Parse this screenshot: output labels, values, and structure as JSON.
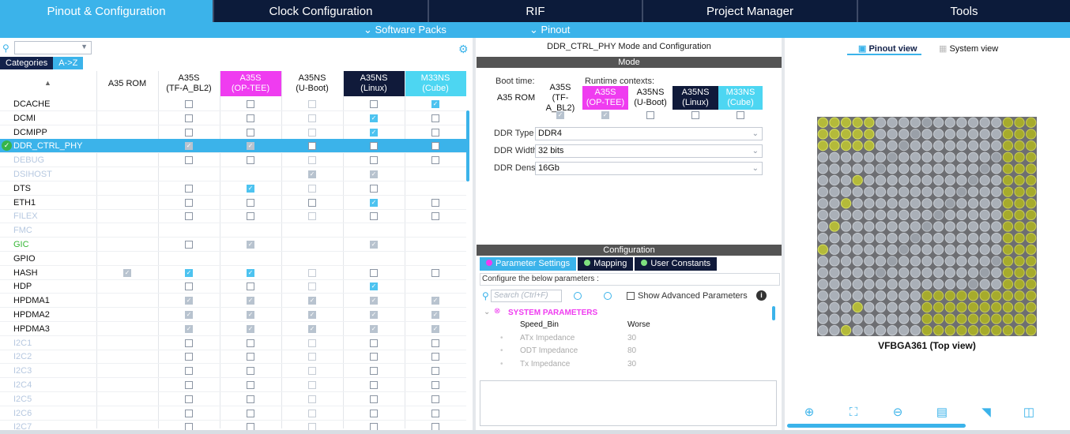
{
  "tabs": [
    {
      "label": "Pinout & Configuration",
      "active": true
    },
    {
      "label": "Clock Configuration",
      "active": false
    },
    {
      "label": "RIF",
      "active": false
    },
    {
      "label": "Project Manager",
      "active": false
    },
    {
      "label": "Tools",
      "active": false
    }
  ],
  "subbar": {
    "software_packs": "⌄ Software Packs",
    "pinout": "⌄ Pinout"
  },
  "left": {
    "category_tabs": [
      "Categories",
      "A->Z"
    ],
    "columns": [
      {
        "label": "A35 ROM",
        "style": "plain"
      },
      {
        "label": "A35S\n(TF-A_BL2)",
        "style": "plain"
      },
      {
        "label": "A35S\n(OP-TEE)",
        "style": "magenta"
      },
      {
        "label": "A35NS\n(U-Boot)",
        "style": "plain"
      },
      {
        "label": "A35NS\n(Linux)",
        "style": "navy"
      },
      {
        "label": "M33NS\n(Cube)",
        "style": "cyan"
      }
    ],
    "rows": [
      {
        "name": "DCACHE",
        "style": "normal",
        "cells": [
          "",
          "off",
          "off",
          "grey",
          "off",
          "on"
        ]
      },
      {
        "name": "DCMI",
        "style": "normal",
        "cells": [
          "",
          "off",
          "off",
          "grey",
          "on",
          "off"
        ]
      },
      {
        "name": "DCMIPP",
        "style": "normal",
        "cells": [
          "",
          "off",
          "off",
          "grey",
          "on",
          "off"
        ]
      },
      {
        "name": "DDR_CTRL_PHY",
        "style": "selected",
        "cells": [
          "",
          "greyon",
          "greyon",
          "off",
          "off",
          "off"
        ]
      },
      {
        "name": "DEBUG",
        "style": "dim",
        "cells": [
          "",
          "off",
          "off",
          "grey",
          "off",
          "off"
        ]
      },
      {
        "name": "DSIHOST",
        "style": "dim",
        "cells": [
          "",
          "",
          "",
          "greyon",
          "greyon",
          ""
        ]
      },
      {
        "name": "DTS",
        "style": "normal",
        "cells": [
          "",
          "off",
          "on",
          "grey",
          "off",
          ""
        ]
      },
      {
        "name": "ETH1",
        "style": "normal",
        "cells": [
          "",
          "off",
          "off",
          "off",
          "on",
          "off"
        ]
      },
      {
        "name": "FILEX",
        "style": "dim",
        "cells": [
          "",
          "off",
          "off",
          "grey",
          "off",
          "off"
        ]
      },
      {
        "name": "FMC",
        "style": "dim",
        "cells": [
          "",
          "",
          "",
          "",
          "",
          ""
        ]
      },
      {
        "name": "GIC",
        "style": "green",
        "cells": [
          "",
          "off",
          "greyon",
          "",
          "greyon",
          ""
        ]
      },
      {
        "name": "GPIO",
        "style": "normal",
        "cells": [
          "",
          "",
          "",
          "",
          "",
          ""
        ]
      },
      {
        "name": "HASH",
        "style": "normal",
        "cells": [
          "greyon",
          "on",
          "on",
          "grey",
          "off",
          "off"
        ]
      },
      {
        "name": "HDP",
        "style": "normal",
        "cells": [
          "",
          "off",
          "off",
          "grey",
          "on",
          ""
        ]
      },
      {
        "name": "HPDMA1",
        "style": "normal",
        "cells": [
          "",
          "greyon",
          "greyon",
          "greyon",
          "greyon",
          "greyon"
        ]
      },
      {
        "name": "HPDMA2",
        "style": "normal",
        "cells": [
          "",
          "greyon",
          "greyon",
          "greyon",
          "greyon",
          "greyon"
        ]
      },
      {
        "name": "HPDMA3",
        "style": "normal",
        "cells": [
          "",
          "greyon",
          "greyon",
          "greyon",
          "greyon",
          "greyon"
        ]
      },
      {
        "name": "I2C1",
        "style": "dim",
        "cells": [
          "",
          "off",
          "off",
          "grey",
          "off",
          "off"
        ]
      },
      {
        "name": "I2C2",
        "style": "dim",
        "cells": [
          "",
          "off",
          "off",
          "grey",
          "off",
          "off"
        ]
      },
      {
        "name": "I2C3",
        "style": "dim",
        "cells": [
          "",
          "off",
          "off",
          "grey",
          "off",
          "off"
        ]
      },
      {
        "name": "I2C4",
        "style": "dim",
        "cells": [
          "",
          "off",
          "off",
          "grey",
          "off",
          "off"
        ]
      },
      {
        "name": "I2C5",
        "style": "dim",
        "cells": [
          "",
          "off",
          "off",
          "grey",
          "off",
          "off"
        ]
      },
      {
        "name": "I2C6",
        "style": "dim",
        "cells": [
          "",
          "off",
          "off",
          "grey",
          "off",
          "off"
        ]
      },
      {
        "name": "I2C7",
        "style": "dim",
        "cells": [
          "",
          "off",
          "off",
          "grey",
          "off",
          "off"
        ]
      }
    ]
  },
  "mode": {
    "title": "DDR_CTRL_PHY Mode and Configuration",
    "bar": "Mode",
    "boot_time": "Boot time:",
    "runtime_contexts": "Runtime contexts:",
    "contexts": [
      {
        "label": "A35 ROM",
        "style": "plain",
        "state": ""
      },
      {
        "label": "A35S\n(TF-A_BL2)",
        "style": "plain",
        "state": "greyon"
      },
      {
        "label": "A35S\n(OP-TEE)",
        "style": "magenta",
        "state": "greyon"
      },
      {
        "label": "A35NS\n(U-Boot)",
        "style": "plain",
        "state": "off"
      },
      {
        "label": "A35NS\n(Linux)",
        "style": "navy",
        "state": "off"
      },
      {
        "label": "M33NS\n(Cube)",
        "style": "cyan",
        "state": "off"
      }
    ],
    "fields": [
      {
        "label": "DDR Type",
        "value": "DDR4"
      },
      {
        "label": "DDR Width",
        "value": "32 bits"
      },
      {
        "label": "DDR Density",
        "value": "16Gb"
      }
    ]
  },
  "config": {
    "bar": "Configuration",
    "tabs": [
      "Parameter Settings",
      "Mapping",
      "User Constants"
    ],
    "hint": "Configure the below parameters :",
    "search_placeholder": "Search (Ctrl+F)",
    "show_advanced": "Show Advanced Parameters",
    "section": "SYSTEM PARAMETERS",
    "params": [
      {
        "name": "Speed_Bin",
        "value": "Worse",
        "dim": false
      },
      {
        "name": "ATx Impedance",
        "value": "30",
        "dim": true
      },
      {
        "name": "ODT Impedance",
        "value": "80",
        "dim": true
      },
      {
        "name": "Tx Impedance",
        "value": "30",
        "dim": true
      }
    ]
  },
  "right": {
    "pinout_view": "Pinout view",
    "system_view": "System view",
    "chip_caption": "VFBGA361 (Top view)"
  },
  "colors": {
    "accent": "#3bb3ea",
    "navy": "#0c1b3a",
    "magenta": "#ef3cf0",
    "cyan": "#4dd6f2"
  }
}
